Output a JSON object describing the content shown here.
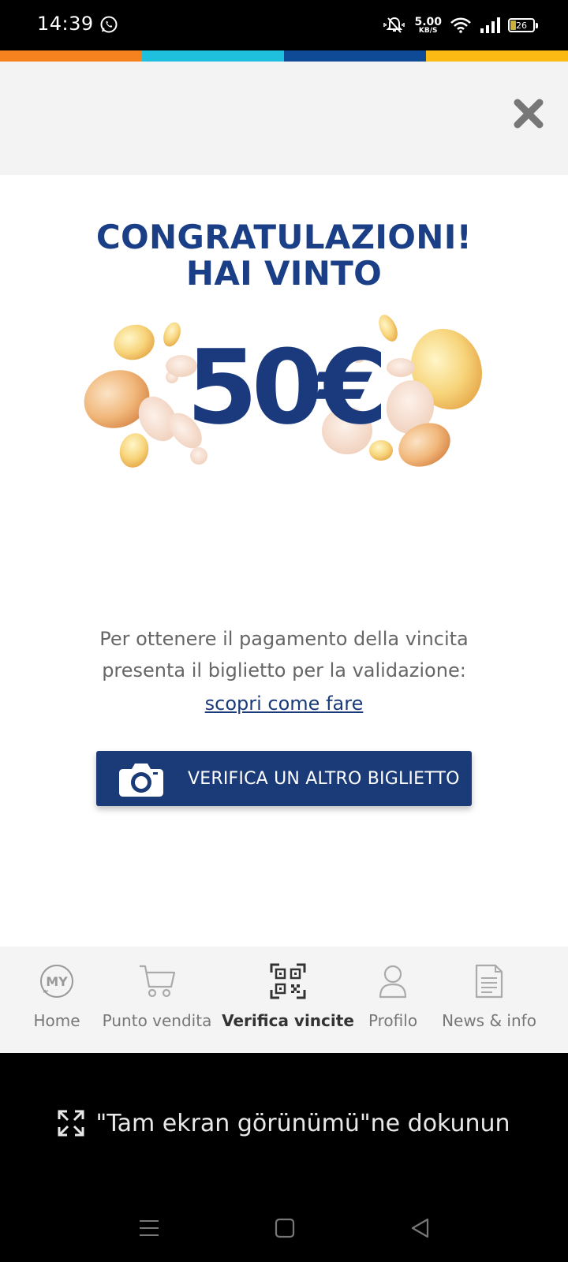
{
  "status_bar": {
    "time": "14:39",
    "net_speed_value": "5.00",
    "net_speed_unit": "KB/S",
    "battery_level": "26"
  },
  "strip_colors": [
    "#f5821f",
    "#1ec0de",
    "#0f4a96",
    "#fbbb14"
  ],
  "headline": {
    "line1": "CONGRATULAZIONI!",
    "line2": "HAI VINTO"
  },
  "prize": "50€",
  "info": {
    "line1": "Per ottenere il pagamento della vincita",
    "line2": "presenta il biglietto per la validazione:",
    "link": "scopri come fare"
  },
  "verify_button": {
    "label": "VERIFICA UN ALTRO BIGLIETTO",
    "icon": "camera-icon"
  },
  "bottom_nav": {
    "items": [
      {
        "label": "Home",
        "icon": "my-logo-icon"
      },
      {
        "label": "Punto vendita",
        "icon": "cart-icon"
      },
      {
        "label": "Verifica vincite",
        "icon": "qr-code-icon",
        "active": true
      },
      {
        "label": "Profilo",
        "icon": "user-icon"
      },
      {
        "label": "News & info",
        "icon": "document-icon"
      }
    ]
  },
  "fullscreen_hint": "\"Tam ekran görünümü\"ne dokunun",
  "colors": {
    "brand_blue": "#1a3f86",
    "button_blue": "#1a3a78"
  }
}
